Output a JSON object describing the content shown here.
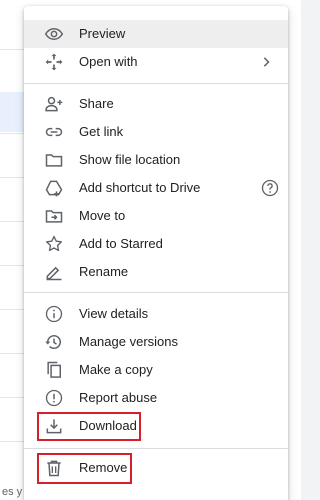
{
  "background": {
    "footer_text": "es y M"
  },
  "menu": {
    "items": [
      {
        "id": "preview",
        "label": "Preview",
        "icon": "eye-icon"
      },
      {
        "id": "open-with",
        "label": "Open with",
        "icon": "move-arrows-icon",
        "submenu_icon": "chevron-right-icon"
      },
      {
        "id": "share",
        "label": "Share",
        "icon": "person-add-icon"
      },
      {
        "id": "get-link",
        "label": "Get link",
        "icon": "link-icon"
      },
      {
        "id": "show-file-location",
        "label": "Show file location",
        "icon": "folder-icon"
      },
      {
        "id": "add-shortcut",
        "label": "Add shortcut to Drive",
        "icon": "drive-shortcut-icon",
        "help_icon": "help-icon"
      },
      {
        "id": "move-to",
        "label": "Move to",
        "icon": "move-to-folder-icon"
      },
      {
        "id": "add-starred",
        "label": "Add to Starred",
        "icon": "star-icon"
      },
      {
        "id": "rename",
        "label": "Rename",
        "icon": "pencil-icon"
      },
      {
        "id": "view-details",
        "label": "View details",
        "icon": "info-icon"
      },
      {
        "id": "manage-versions",
        "label": "Manage versions",
        "icon": "history-icon"
      },
      {
        "id": "make-copy",
        "label": "Make a copy",
        "icon": "copy-icon"
      },
      {
        "id": "report-abuse",
        "label": "Report abuse",
        "icon": "alert-icon"
      },
      {
        "id": "download",
        "label": "Download",
        "icon": "download-icon"
      },
      {
        "id": "remove",
        "label": "Remove",
        "icon": "trash-icon"
      }
    ]
  },
  "colors": {
    "highlight": "#eeeeee",
    "callout": "#d81e2a",
    "icon": "#5f6368",
    "text": "#202124"
  }
}
